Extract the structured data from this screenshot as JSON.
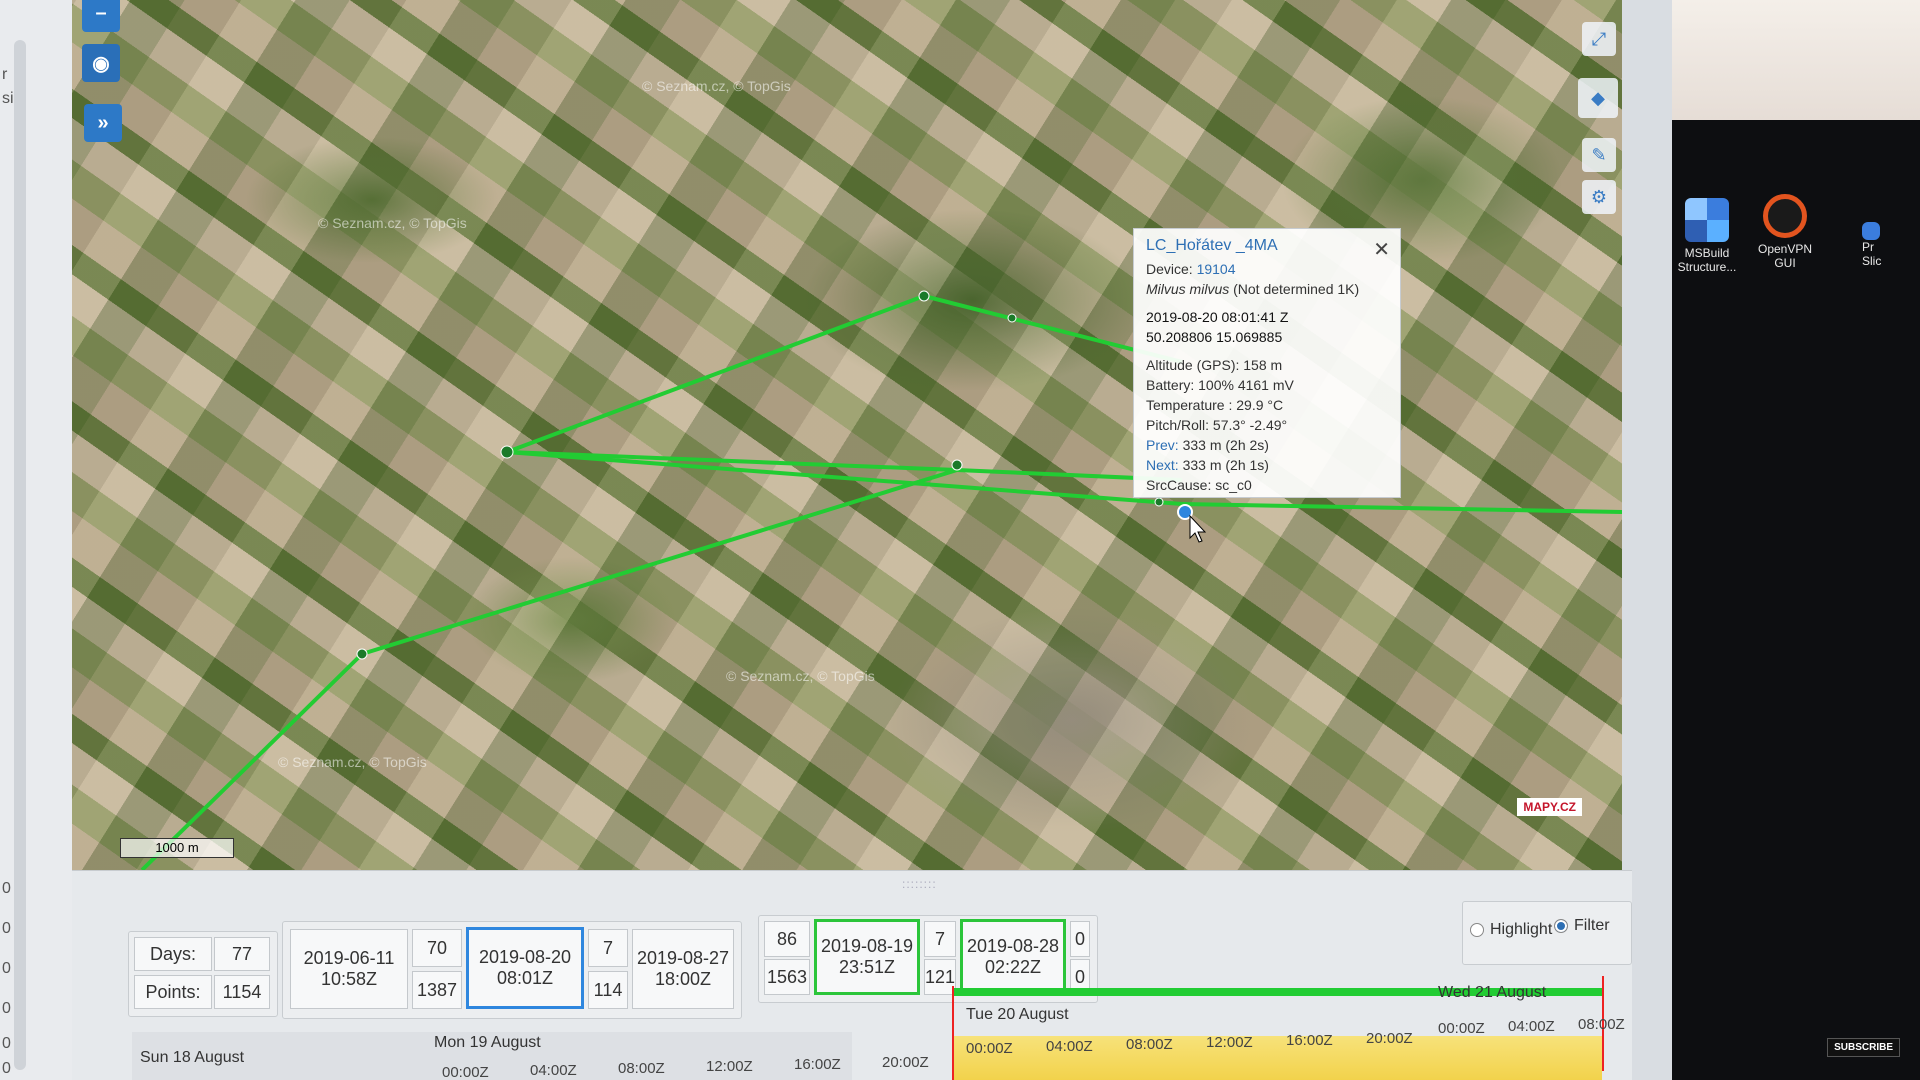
{
  "map": {
    "watermarks": [
      "© Seznam.cz, © TopGis",
      "© Seznam.cz, © TopGis",
      "© Seznam.cz, © TopGis",
      "© Seznam.cz, © TopGis"
    ],
    "scale": "1000 m",
    "logo": "MAPY.CZ",
    "zoom_out_label": "–",
    "track_color": "#22cc33"
  },
  "popup": {
    "title": "LC_Hořátev _4MA",
    "device_label": "Device:",
    "device_value": "19104",
    "species": "Milvus milvus",
    "species_note": "(Not determined 1K)",
    "datetime": "2019-08-20 08:01:41 Z",
    "coords": "50.208806 15.069885",
    "altitude": "Altitude (GPS): 158 m",
    "battery": "Battery: 100% 4161 mV",
    "temperature": "Temperature : 29.9 °C",
    "pitch_roll": "Pitch/Roll: 57.3° -2.49°",
    "prev_label": "Prev:",
    "prev_value": "333 m (2h 2s)",
    "next_label": "Next:",
    "next_value": "333 m (2h 1s)",
    "src_cause": "SrcCause: sc_c0"
  },
  "stats": {
    "days_label": "Days:",
    "days_value": "77",
    "points_label": "Points:",
    "points_value": "1154"
  },
  "range": {
    "start": "2019-06-11\n10:58Z",
    "count_a_top": "70",
    "count_a_bottom": "1387",
    "selected": "2019-08-20\n08:01Z",
    "count_b_top": "7",
    "count_b_bottom": "114",
    "end": "2019-08-27\n18:00Z"
  },
  "window": {
    "count_top": "86",
    "count_bottom": "1563",
    "from": "2019-08-19\n23:51Z",
    "mid_top": "7",
    "mid_bottom": "121",
    "to": "2019-08-28\n02:22Z",
    "right_top": "0",
    "right_bottom": "0"
  },
  "modes": {
    "highlight": "Highlight",
    "filter": "Filter",
    "selected": "Filter"
  },
  "timeline": {
    "days": [
      "Sun 18 August",
      "Mon 19 August",
      "Tue 20 August",
      "Wed 21 August"
    ],
    "ticks_mon": [
      "00:00Z",
      "04:00Z",
      "08:00Z",
      "12:00Z",
      "16:00Z",
      "20:00Z"
    ],
    "ticks_tue": [
      "00:00Z",
      "04:00Z",
      "08:00Z",
      "12:00Z",
      "16:00Z",
      "20:00Z"
    ],
    "ticks_wed": [
      "00:00Z",
      "04:00Z",
      "08:00Z"
    ]
  },
  "desktop": {
    "icons": [
      {
        "label": "MSBuild\nStructure...",
        "name": "msbuild-icon"
      },
      {
        "label": "OpenVPN\nGUI",
        "name": "openvpn-icon"
      },
      {
        "label": "Pr\nSlic",
        "name": "app-icon"
      }
    ],
    "subscribe": "SUBSCRIBE"
  },
  "left_numbers": [
    "r",
    "si",
    "0",
    "0",
    "0",
    "0",
    "0",
    "0"
  ]
}
